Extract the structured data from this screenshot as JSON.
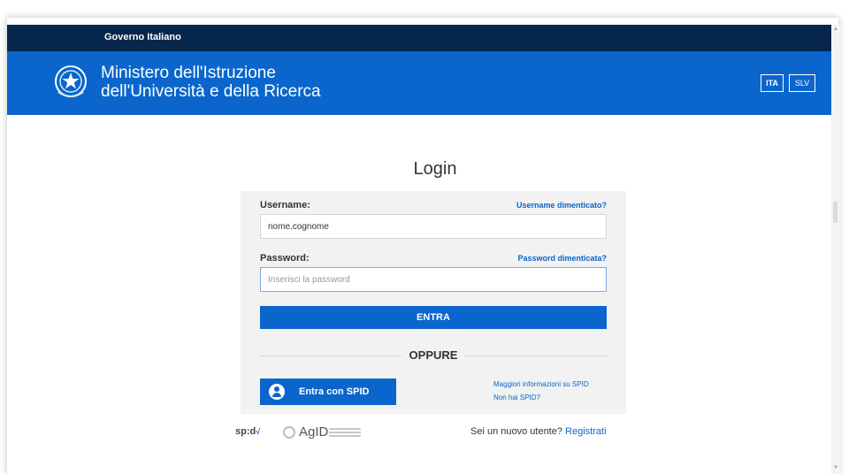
{
  "header": {
    "gov_label": "Governo Italiano",
    "ministry_line1": "Ministero dell'Istruzione",
    "ministry_line2": "dell'Università e della Ricerca",
    "languages": [
      "ITA",
      "SLV"
    ],
    "selected_language": "ITA"
  },
  "login": {
    "title": "Login",
    "username_label": "Username:",
    "username_forgot": "Username dimenticato?",
    "username_value": "nome.cognome",
    "password_label": "Password:",
    "password_forgot": "Password dimenticata?",
    "password_placeholder": "Inserisci la password",
    "submit_label": "ENTRA",
    "or_label": "OPPURE",
    "spid_button_label": "Entra con SPID",
    "spid_info_link": "Maggiori informazioni su SPID",
    "spid_none_link": "Non hai SPID?"
  },
  "footer": {
    "spid_logo_text": "sp:d",
    "spid_logo_mark": "√",
    "agid_logo_text": "AgID",
    "new_user_text": "Sei un nuovo utente?",
    "register_link": "Registrati"
  },
  "colors": {
    "gov_bar": "#06264b",
    "ministry_bar": "#0a66cc",
    "accent": "#0a66cc",
    "form_bg": "#f2f2f2"
  },
  "icons": [
    "italian-emblem-icon",
    "spid-user-icon",
    "agid-logo-icon"
  ]
}
